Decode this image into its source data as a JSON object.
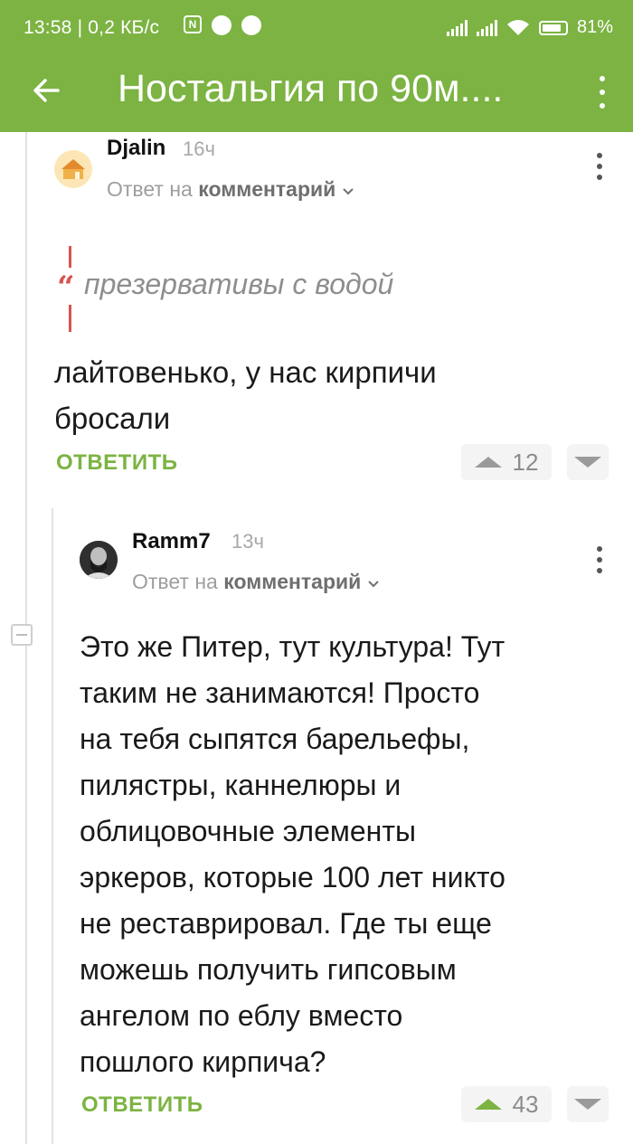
{
  "status_bar": {
    "time": "13:58 | 0,2 КБ/с",
    "battery": "81%"
  },
  "toolbar": {
    "title": "Ностальгия по 90м....",
    "back_icon": "arrow-left-icon",
    "menu_icon": "more-vertical-icon"
  },
  "comments": [
    {
      "username": "Djalin",
      "time": "16ч",
      "reply_to_prefix": "Ответ на",
      "reply_to_link": "комментарий",
      "quote": "презервативы с водой",
      "text_lines": [
        "лайтовенько, у нас кирпичи",
        "бросали"
      ],
      "reply_label": "ОТВЕТИТЬ",
      "rating": "12"
    },
    {
      "username": "Ramm7",
      "time": "13ч",
      "reply_to_prefix": "Ответ на",
      "reply_to_link": "комментарий",
      "text_lines": [
        "Это же Питер, тут культура! Тут",
        "таким не занимаются! Просто",
        "на тебя сыпятся барельефы,",
        "пилястры, каннелюры и",
        "облицовочные элементы",
        "эркеров, которые 100 лет никто",
        "не реставрировал. Где ты еще",
        "можешь получить гипсовым",
        "ангелом по еблу вместо",
        "пошлого кирпича?"
      ],
      "reply_label": "ОТВЕТИТЬ",
      "rating": "43"
    }
  ],
  "colors": {
    "accent": "#7cb342",
    "quote": "#d9534f"
  }
}
